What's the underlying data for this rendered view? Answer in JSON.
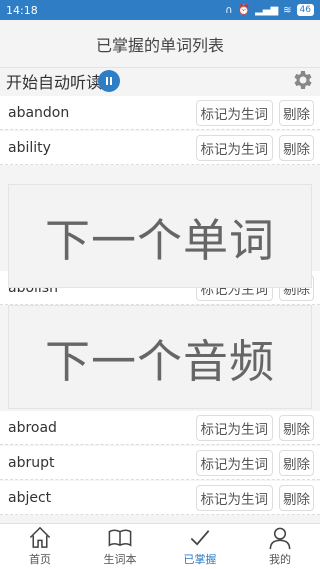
{
  "status": {
    "time": "14:18",
    "battery": "46"
  },
  "header": {
    "title": "已掌握的单词列表"
  },
  "toolbar": {
    "auto_listen_label": "开始自动听读"
  },
  "words": [
    {
      "word": "abandon",
      "mark_label": "标记为生词",
      "delete_label": "剔除"
    },
    {
      "word": "ability",
      "mark_label": "标记为生词",
      "delete_label": "剔除"
    },
    {
      "word": "abolish",
      "mark_label": "标记为生词",
      "delete_label": "剔除"
    },
    {
      "word": "abroad",
      "mark_label": "标记为生词",
      "delete_label": "剔除"
    },
    {
      "word": "abrupt",
      "mark_label": "标记为生词",
      "delete_label": "剔除"
    },
    {
      "word": "abject",
      "mark_label": "标记为生词",
      "delete_label": "剔除"
    }
  ],
  "overlay": {
    "next_word_label": "下一个单词",
    "next_audio_label": "下一个音频"
  },
  "tabs": [
    {
      "label": "首页",
      "icon": "home-icon"
    },
    {
      "label": "生词本",
      "icon": "book-icon"
    },
    {
      "label": "已掌握",
      "icon": "check-icon",
      "active": true
    },
    {
      "label": "我的",
      "icon": "user-icon"
    }
  ],
  "colors": {
    "accent": "#2f7dc5"
  }
}
